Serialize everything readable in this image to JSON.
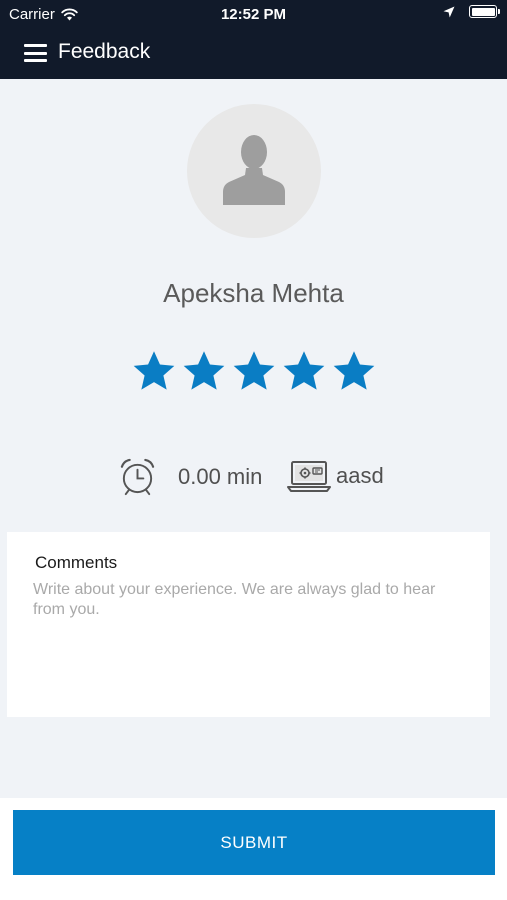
{
  "status_bar": {
    "carrier": "Carrier",
    "time": "12:52 PM",
    "icons": [
      "wifi-icon",
      "location-arrow-icon",
      "battery-icon"
    ]
  },
  "header": {
    "menu_icon": "hamburger-menu-icon",
    "title": "Feedback"
  },
  "profile": {
    "avatar_icon": "person-silhouette-icon",
    "name": "Apeksha Mehta"
  },
  "rating": {
    "value": 5,
    "max": 5,
    "icon": "star-icon"
  },
  "session": {
    "duration": "0.00 min",
    "duration_icon": "alarm-clock-icon",
    "device_name": "aasd",
    "device_icon": "laptop-settings-icon"
  },
  "comments": {
    "label": "Comments",
    "value": "",
    "placeholder": "Write about your experience. We are always glad to hear from you."
  },
  "submit": {
    "label": "SUBMIT"
  },
  "colors": {
    "header_bg": "#111a2a",
    "content_bg": "#f0f3f7",
    "accent": "#0680c6",
    "star": "#0a7dc4"
  }
}
